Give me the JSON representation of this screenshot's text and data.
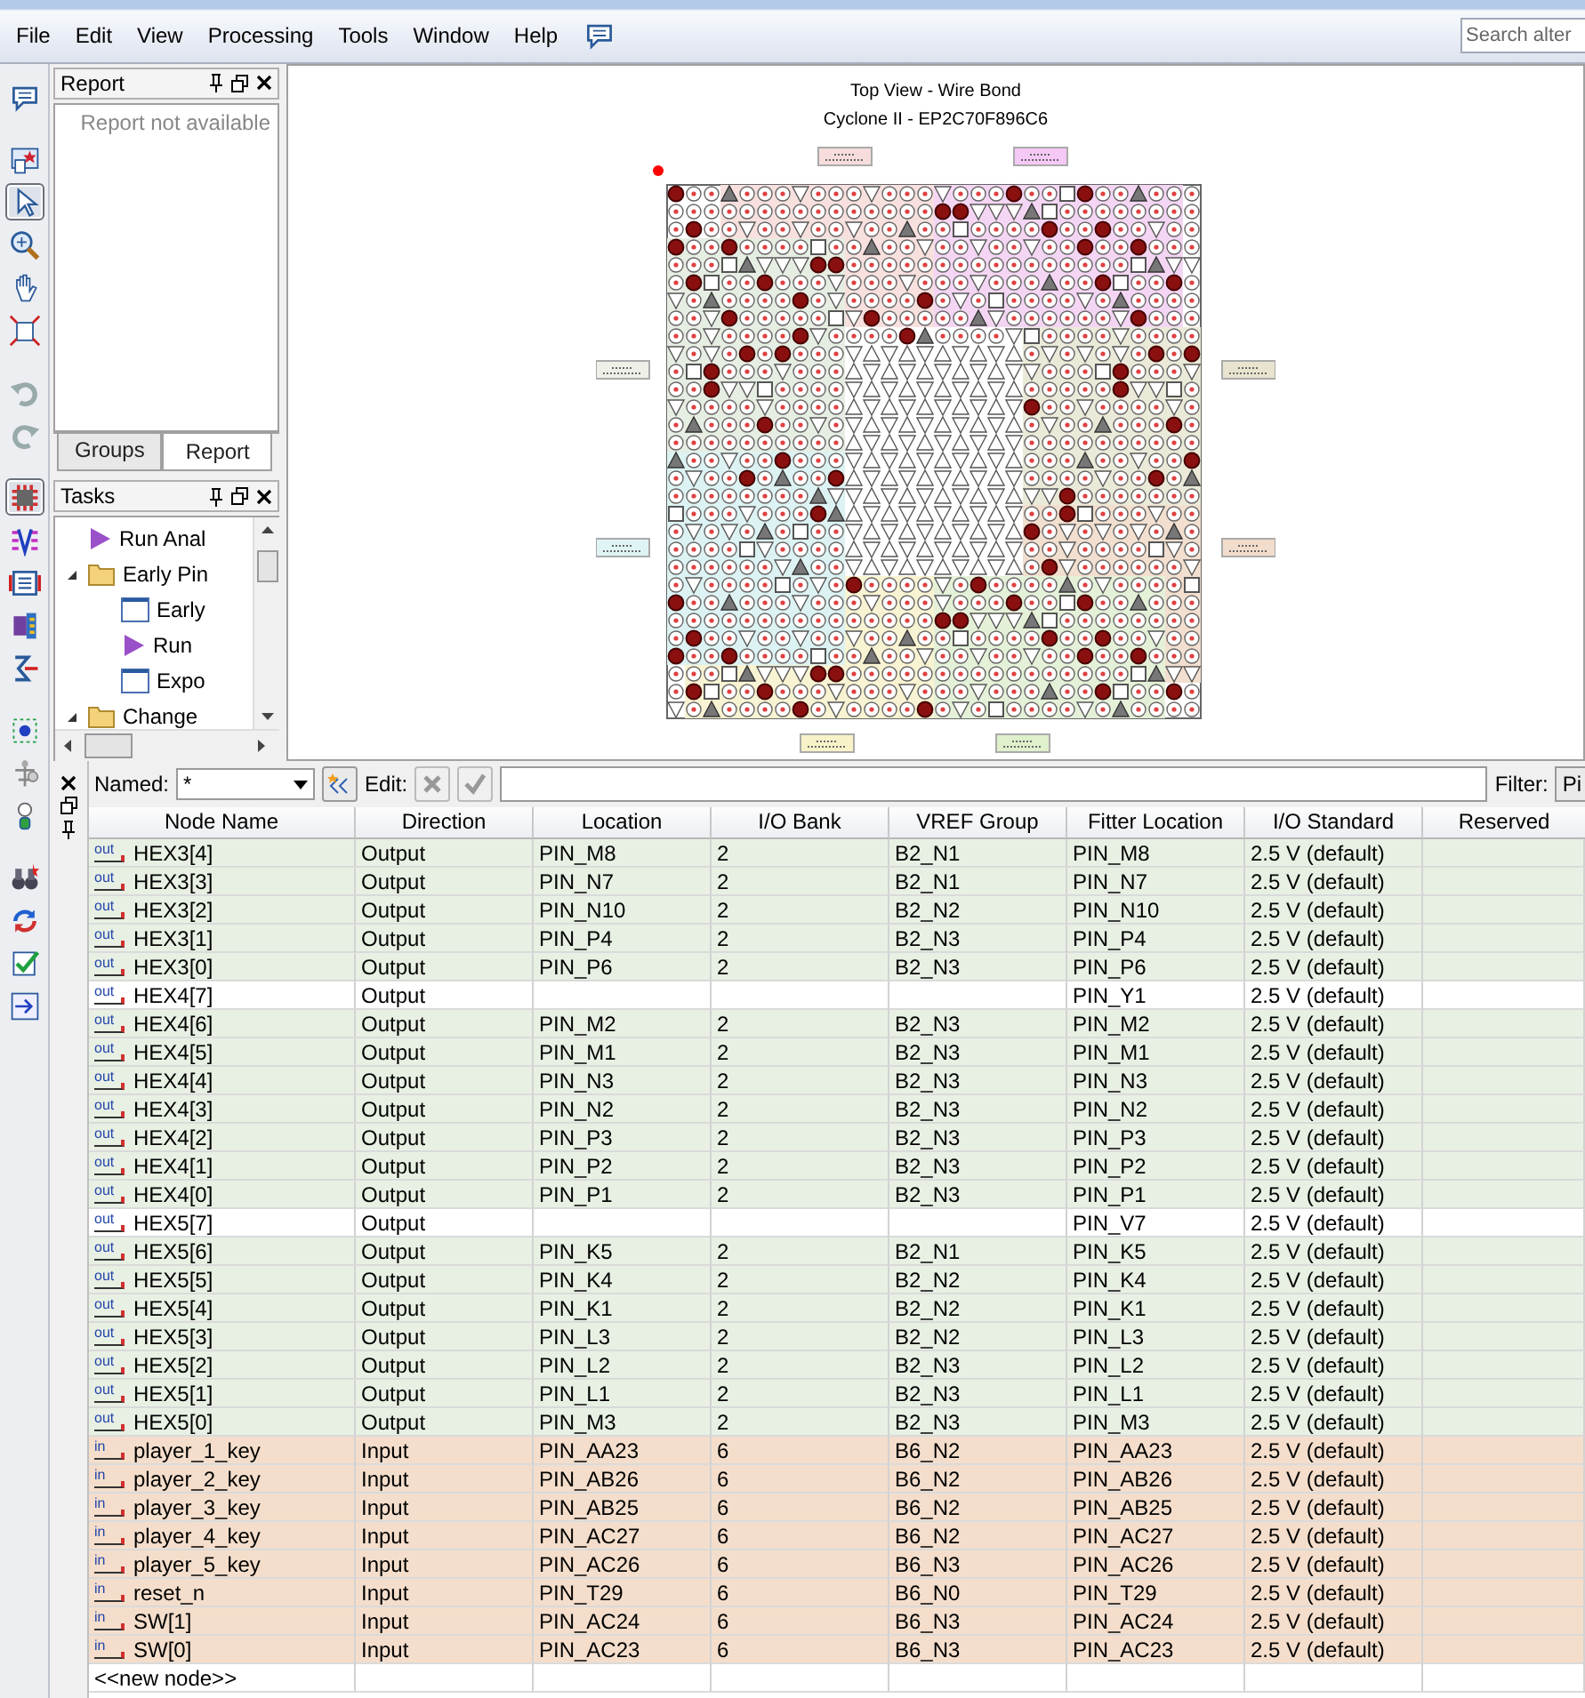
{
  "menu": [
    "File",
    "Edit",
    "View",
    "Processing",
    "Tools",
    "Window",
    "Help"
  ],
  "search": {
    "placeholder": "Search alter"
  },
  "toolbar": [
    {
      "kind": "comment",
      "selected": false
    },
    {
      "kind": "report",
      "selected": false
    },
    {
      "kind": "pointer",
      "selected": true
    },
    {
      "kind": "zoom",
      "selected": false
    },
    {
      "kind": "hand",
      "selected": false
    },
    {
      "kind": "fit",
      "selected": false
    },
    {
      "kind": "undo",
      "selected": false
    },
    {
      "kind": "redo",
      "selected": false
    },
    {
      "kind": "pins",
      "selected": true
    },
    {
      "kind": "vref",
      "selected": false
    },
    {
      "kind": "editor",
      "selected": false
    },
    {
      "kind": "puzzle",
      "selected": false
    },
    {
      "kind": "diff",
      "selected": false
    },
    {
      "kind": "probe",
      "selected": false
    },
    {
      "kind": "tree",
      "selected": false
    },
    {
      "kind": "bulb",
      "selected": false
    },
    {
      "kind": "binoculars",
      "selected": false
    },
    {
      "kind": "refresh",
      "selected": false
    },
    {
      "kind": "check",
      "selected": false
    },
    {
      "kind": "io",
      "selected": false
    }
  ],
  "report": {
    "title": "Report",
    "message": "Report not available"
  },
  "tabs": [
    {
      "label": "Groups",
      "selected": false
    },
    {
      "label": "Report",
      "selected": true
    }
  ],
  "tasks": {
    "title": "Tasks",
    "items": [
      {
        "label": "Run Anal",
        "kind": "run"
      },
      {
        "label": "Early Pin",
        "kind": "folder",
        "expanded": true,
        "children": [
          {
            "label": "Early",
            "kind": "doc"
          },
          {
            "label": "Run",
            "kind": "run"
          },
          {
            "label": "Expo",
            "kind": "doc"
          }
        ]
      },
      {
        "label": "Change",
        "kind": "folder",
        "expanded": true
      }
    ]
  },
  "package": {
    "title": "Top View - Wire Bond",
    "device": "Cyclone II - EP2C70F896C6"
  },
  "filter": {
    "named_label": "Named:",
    "named_value": "*",
    "edit_label": "Edit:",
    "filter_label": "Filter:",
    "filter_button": "Pi"
  },
  "table": {
    "columns": [
      "Node Name",
      "Direction",
      "Location",
      "I/O Bank",
      "VREF Group",
      "Fitter Location",
      "I/O Standard",
      "Reserved"
    ],
    "rows": [
      {
        "tag": "out",
        "name": "HEX3[4]",
        "direction": "Output",
        "location": "PIN_M8",
        "bank": "2",
        "vref": "B2_N1",
        "fitter": "PIN_M8",
        "standard": "2.5 V (default)",
        "color": "#e8f0e4"
      },
      {
        "tag": "out",
        "name": "HEX3[3]",
        "direction": "Output",
        "location": "PIN_N7",
        "bank": "2",
        "vref": "B2_N1",
        "fitter": "PIN_N7",
        "standard": "2.5 V (default)",
        "color": "#e8f0e4"
      },
      {
        "tag": "out",
        "name": "HEX3[2]",
        "direction": "Output",
        "location": "PIN_N10",
        "bank": "2",
        "vref": "B2_N2",
        "fitter": "PIN_N10",
        "standard": "2.5 V (default)",
        "color": "#e8f0e4"
      },
      {
        "tag": "out",
        "name": "HEX3[1]",
        "direction": "Output",
        "location": "PIN_P4",
        "bank": "2",
        "vref": "B2_N3",
        "fitter": "PIN_P4",
        "standard": "2.5 V (default)",
        "color": "#e8f0e4"
      },
      {
        "tag": "out",
        "name": "HEX3[0]",
        "direction": "Output",
        "location": "PIN_P6",
        "bank": "2",
        "vref": "B2_N3",
        "fitter": "PIN_P6",
        "standard": "2.5 V (default)",
        "color": "#e8f0e4"
      },
      {
        "tag": "out",
        "name": "HEX4[7]",
        "direction": "Output",
        "fitter": "PIN_Y1",
        "standard": "2.5 V (default)",
        "color": "#ffffff"
      },
      {
        "tag": "out",
        "name": "HEX4[6]",
        "direction": "Output",
        "location": "PIN_M2",
        "bank": "2",
        "vref": "B2_N3",
        "fitter": "PIN_M2",
        "standard": "2.5 V (default)",
        "color": "#e8f0e4"
      },
      {
        "tag": "out",
        "name": "HEX4[5]",
        "direction": "Output",
        "location": "PIN_M1",
        "bank": "2",
        "vref": "B2_N3",
        "fitter": "PIN_M1",
        "standard": "2.5 V (default)",
        "color": "#e8f0e4"
      },
      {
        "tag": "out",
        "name": "HEX4[4]",
        "direction": "Output",
        "location": "PIN_N3",
        "bank": "2",
        "vref": "B2_N3",
        "fitter": "PIN_N3",
        "standard": "2.5 V (default)",
        "color": "#e8f0e4"
      },
      {
        "tag": "out",
        "name": "HEX4[3]",
        "direction": "Output",
        "location": "PIN_N2",
        "bank": "2",
        "vref": "B2_N3",
        "fitter": "PIN_N2",
        "standard": "2.5 V (default)",
        "color": "#e8f0e4"
      },
      {
        "tag": "out",
        "name": "HEX4[2]",
        "direction": "Output",
        "location": "PIN_P3",
        "bank": "2",
        "vref": "B2_N3",
        "fitter": "PIN_P3",
        "standard": "2.5 V (default)",
        "color": "#e8f0e4"
      },
      {
        "tag": "out",
        "name": "HEX4[1]",
        "direction": "Output",
        "location": "PIN_P2",
        "bank": "2",
        "vref": "B2_N3",
        "fitter": "PIN_P2",
        "standard": "2.5 V (default)",
        "color": "#e8f0e4"
      },
      {
        "tag": "out",
        "name": "HEX4[0]",
        "direction": "Output",
        "location": "PIN_P1",
        "bank": "2",
        "vref": "B2_N3",
        "fitter": "PIN_P1",
        "standard": "2.5 V (default)",
        "color": "#e8f0e4"
      },
      {
        "tag": "out",
        "name": "HEX5[7]",
        "direction": "Output",
        "fitter": "PIN_V7",
        "standard": "2.5 V (default)",
        "color": "#ffffff"
      },
      {
        "tag": "out",
        "name": "HEX5[6]",
        "direction": "Output",
        "location": "PIN_K5",
        "bank": "2",
        "vref": "B2_N1",
        "fitter": "PIN_K5",
        "standard": "2.5 V (default)",
        "color": "#e8f0e4"
      },
      {
        "tag": "out",
        "name": "HEX5[5]",
        "direction": "Output",
        "location": "PIN_K4",
        "bank": "2",
        "vref": "B2_N2",
        "fitter": "PIN_K4",
        "standard": "2.5 V (default)",
        "color": "#e8f0e4"
      },
      {
        "tag": "out",
        "name": "HEX5[4]",
        "direction": "Output",
        "location": "PIN_K1",
        "bank": "2",
        "vref": "B2_N2",
        "fitter": "PIN_K1",
        "standard": "2.5 V (default)",
        "color": "#e8f0e4"
      },
      {
        "tag": "out",
        "name": "HEX5[3]",
        "direction": "Output",
        "location": "PIN_L3",
        "bank": "2",
        "vref": "B2_N2",
        "fitter": "PIN_L3",
        "standard": "2.5 V (default)",
        "color": "#e8f0e4"
      },
      {
        "tag": "out",
        "name": "HEX5[2]",
        "direction": "Output",
        "location": "PIN_L2",
        "bank": "2",
        "vref": "B2_N3",
        "fitter": "PIN_L2",
        "standard": "2.5 V (default)",
        "color": "#e8f0e4"
      },
      {
        "tag": "out",
        "name": "HEX5[1]",
        "direction": "Output",
        "location": "PIN_L1",
        "bank": "2",
        "vref": "B2_N3",
        "fitter": "PIN_L1",
        "standard": "2.5 V (default)",
        "color": "#e8f0e4"
      },
      {
        "tag": "out",
        "name": "HEX5[0]",
        "direction": "Output",
        "location": "PIN_M3",
        "bank": "2",
        "vref": "B2_N3",
        "fitter": "PIN_M3",
        "standard": "2.5 V (default)",
        "color": "#e8f0e4"
      },
      {
        "tag": "in",
        "name": "player_1_key",
        "direction": "Input",
        "location": "PIN_AA23",
        "bank": "6",
        "vref": "B6_N2",
        "fitter": "PIN_AA23",
        "standard": "2.5 V (default)",
        "color": "#f4decb"
      },
      {
        "tag": "in",
        "name": "player_2_key",
        "direction": "Input",
        "location": "PIN_AB26",
        "bank": "6",
        "vref": "B6_N2",
        "fitter": "PIN_AB26",
        "standard": "2.5 V (default)",
        "color": "#f4decb"
      },
      {
        "tag": "in",
        "name": "player_3_key",
        "direction": "Input",
        "location": "PIN_AB25",
        "bank": "6",
        "vref": "B6_N2",
        "fitter": "PIN_AB25",
        "standard": "2.5 V (default)",
        "color": "#f4decb"
      },
      {
        "tag": "in",
        "name": "player_4_key",
        "direction": "Input",
        "location": "PIN_AC27",
        "bank": "6",
        "vref": "B6_N2",
        "fitter": "PIN_AC27",
        "standard": "2.5 V (default)",
        "color": "#f4decb"
      },
      {
        "tag": "in",
        "name": "player_5_key",
        "direction": "Input",
        "location": "PIN_AC26",
        "bank": "6",
        "vref": "B6_N3",
        "fitter": "PIN_AC26",
        "standard": "2.5 V (default)",
        "color": "#f4decb"
      },
      {
        "tag": "in",
        "name": "reset_n",
        "direction": "Input",
        "location": "PIN_T29",
        "bank": "6",
        "vref": "B6_N0",
        "fitter": "PIN_T29",
        "standard": "2.5 V (default)",
        "color": "#f4decb"
      },
      {
        "tag": "in",
        "name": "SW[1]",
        "direction": "Input",
        "location": "PIN_AC24",
        "bank": "6",
        "vref": "B6_N3",
        "fitter": "PIN_AC24",
        "standard": "2.5 V (default)",
        "color": "#f4decb"
      },
      {
        "tag": "in",
        "name": "SW[0]",
        "direction": "Input",
        "location": "PIN_AC23",
        "bank": "6",
        "vref": "B6_N3",
        "fitter": "PIN_AC23",
        "standard": "2.5 V (default)",
        "color": "#f4decb"
      }
    ],
    "new_row": "<<new node>>"
  }
}
